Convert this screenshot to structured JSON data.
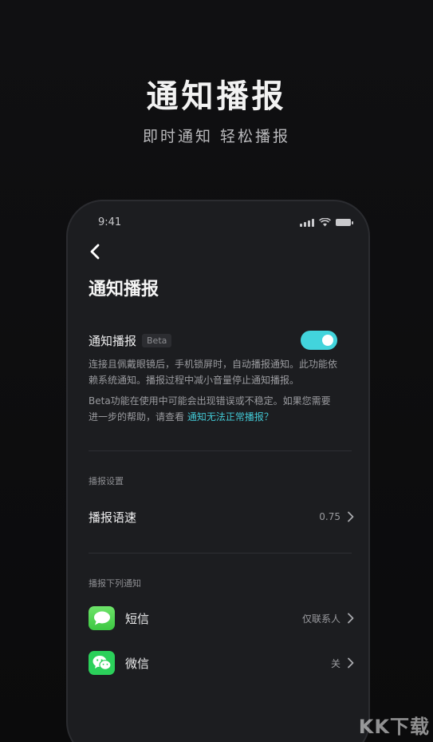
{
  "hero": {
    "title": "通知播报",
    "subtitle": "即时通知 轻松播报"
  },
  "status_bar": {
    "time": "9:41"
  },
  "screen": {
    "title": "通知播报",
    "toggle": {
      "label": "通知播报",
      "badge": "Beta",
      "enabled": true,
      "accent_color": "#42d4dc"
    },
    "description_1": "连接且佩戴眼镜后，手机锁屏时，自动播报通知。此功能依赖系统通知。播报过程中减小音量停止通知播报。",
    "description_2": "Beta功能在使用中可能会出现错误或不稳定。如果您需要进一步的帮助，请查看",
    "help_link": "通知无法正常播报？",
    "broadcast_settings": {
      "section_label": "播报设置",
      "speed_label": "播报语速",
      "speed_value": "0.75"
    },
    "notify_apps": {
      "section_label": "播报下列通知",
      "sms": {
        "label": "短信",
        "value": "仅联系人",
        "icon": "message-bubble-icon"
      },
      "wechat": {
        "label": "微信",
        "value": "关",
        "icon": "wechat-icon"
      }
    }
  },
  "watermark": "KK下载"
}
